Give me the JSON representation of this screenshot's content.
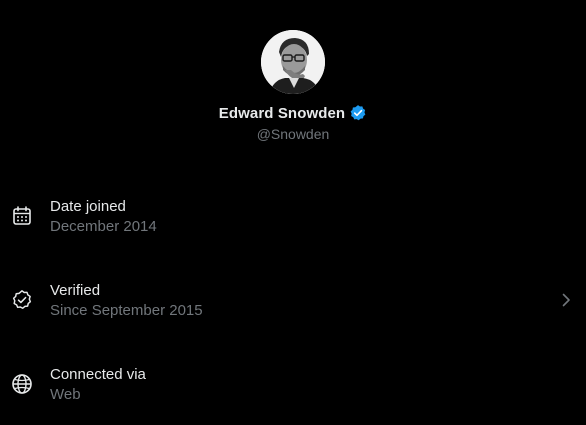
{
  "profile": {
    "display_name": "Edward Snowden",
    "handle": "@Snowden",
    "verified_icon": "verified-badge-icon",
    "verified_color": "#1d9bf0"
  },
  "rows": [
    {
      "icon": "calendar-icon",
      "title": "Date joined",
      "subtitle": "December 2014"
    },
    {
      "icon": "verified-check-icon",
      "title": "Verified",
      "subtitle": "Since September 2015",
      "trailing_icon": "chevron-right-icon"
    },
    {
      "icon": "globe-icon",
      "title": "Connected via",
      "subtitle": "Web"
    }
  ],
  "colors": {
    "background": "#000000",
    "primary_text": "#e7e9ea",
    "secondary_text": "#71767b"
  }
}
